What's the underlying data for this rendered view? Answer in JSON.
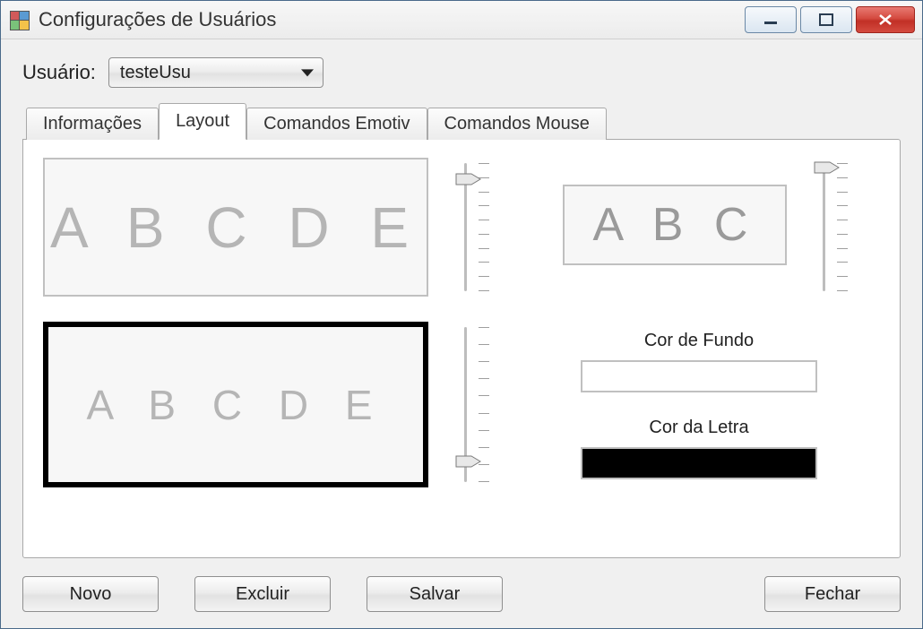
{
  "window": {
    "title": "Configurações de Usuários"
  },
  "user": {
    "label": "Usuário:",
    "selected": "testeUsu"
  },
  "tabs": [
    {
      "label": "Informações"
    },
    {
      "label": "Layout"
    },
    {
      "label": "Comandos Emotiv"
    },
    {
      "label": "Comandos Mouse"
    }
  ],
  "active_tab_index": 1,
  "layout": {
    "preview_big_text": "A B C D E",
    "preview_small_text": "A B C",
    "preview_thick_text": "A B C D E",
    "slider1_percent": 10,
    "slider2_percent": 8,
    "slider3_percent": 85,
    "caption_bg": "Cor de Fundo",
    "caption_fg": "Cor da Letra",
    "color_bg": "#ffffff",
    "color_fg": "#000000"
  },
  "buttons": {
    "novo": "Novo",
    "excluir": "Excluir",
    "salvar": "Salvar",
    "fechar": "Fechar"
  }
}
